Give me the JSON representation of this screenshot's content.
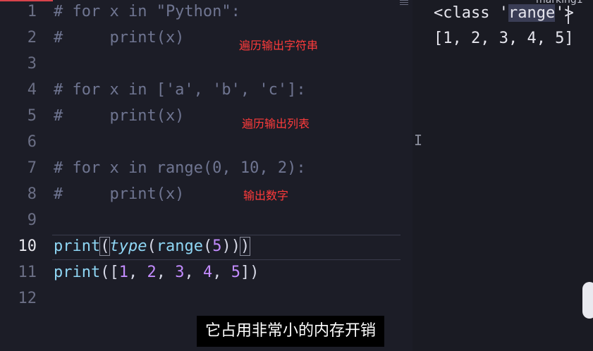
{
  "editor": {
    "active_line": "10",
    "line_numbers": [
      "1",
      "2",
      "3",
      "4",
      "5",
      "6",
      "7",
      "8",
      "9",
      "10",
      "11",
      "12"
    ],
    "lines": {
      "l1": "# for x in \"Python\":",
      "l2": "#     print(x)",
      "l4": "# for x in ['a', 'b', 'c']:",
      "l5": "#     print(x)",
      "l7": "# for x in range(0, 10, 2):",
      "l8": "#     print(x)",
      "l10": {
        "fn": "print",
        "open1": "(",
        "type": "type",
        "open2": "(",
        "range": "range",
        "open3": "(",
        "num": "5",
        "close": "))",
        "close_last": ")"
      },
      "l11": {
        "fn": "print",
        "open": "([",
        "n1": "1",
        "n2": "2",
        "n3": "3",
        "n4": "4",
        "n5": "5",
        "sep": ", ",
        "close": "])"
      }
    },
    "annotations": {
      "a1": "遍历输出字符串",
      "a2": "遍历输出列表",
      "a3": "输出数字"
    }
  },
  "output": {
    "top_label": "marking1",
    "line1_pre": "<class '",
    "line1_sel": "range",
    "line1_post": "'>",
    "line2": "[1, 2, 3, 4, 5]"
  },
  "caption": "它占用非常小的内存开销",
  "icons": [
    "minimap-icon",
    "ibeam-cursor-icon"
  ],
  "colors": {
    "annotation": "#ff3b3b",
    "comment": "#6f7591",
    "function": "#8fd6f4",
    "number": "#c38cff",
    "background": "#1c1d27"
  }
}
